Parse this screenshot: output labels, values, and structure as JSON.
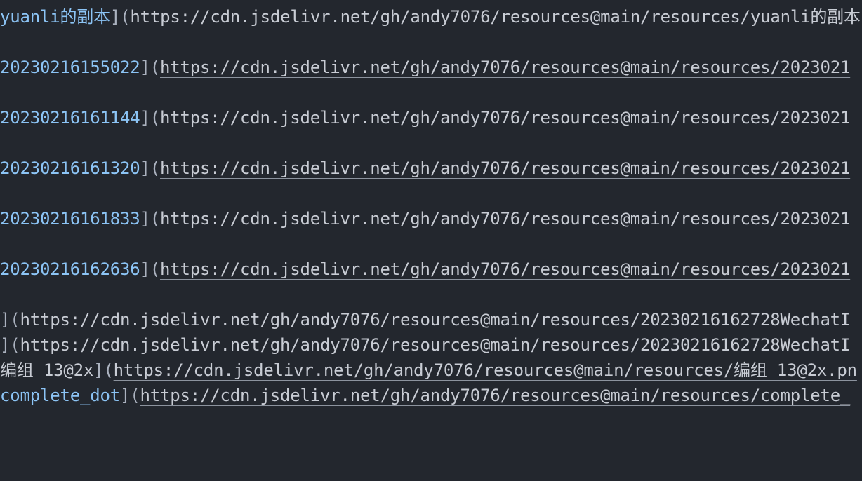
{
  "colors": {
    "background": "#23272e",
    "alt_text": "#8cc4f5",
    "bracket": "#abb2bf",
    "url": "#c8ccd4"
  },
  "lines": [
    {
      "alt": "yuanli的副本",
      "open": "](",
      "url": "https://cdn.jsdelivr.net/gh/andy7076/resources@main/resources/yuanli的副本"
    },
    {
      "alt": "20230216155022",
      "open": "](",
      "url": "https://cdn.jsdelivr.net/gh/andy7076/resources@main/resources/2023021"
    },
    {
      "alt": "20230216161144",
      "open": "](",
      "url": "https://cdn.jsdelivr.net/gh/andy7076/resources@main/resources/2023021"
    },
    {
      "alt": "20230216161320",
      "open": "](",
      "url": "https://cdn.jsdelivr.net/gh/andy7076/resources@main/resources/2023021"
    },
    {
      "alt": "20230216161833",
      "open": "](",
      "url": "https://cdn.jsdelivr.net/gh/andy7076/resources@main/resources/2023021"
    },
    {
      "alt": "20230216162636",
      "open": "](",
      "url": "https://cdn.jsdelivr.net/gh/andy7076/resources@main/resources/2023021"
    },
    {
      "alt": "",
      "open": "](",
      "url": "https://cdn.jsdelivr.net/gh/andy7076/resources@main/resources/20230216162728WechatI"
    },
    {
      "alt": "",
      "open": "](",
      "url": "https://cdn.jsdelivr.net/gh/andy7076/resources@main/resources/20230216162728WechatI"
    },
    {
      "alt": "编组 13@2x",
      "open": "](",
      "url": "https://cdn.jsdelivr.net/gh/andy7076/resources@main/resources/编组 13@2x.pn"
    },
    {
      "alt": "complete_dot",
      "open": "](",
      "url": "https://cdn.jsdelivr.net/gh/andy7076/resources@main/resources/complete_"
    }
  ]
}
